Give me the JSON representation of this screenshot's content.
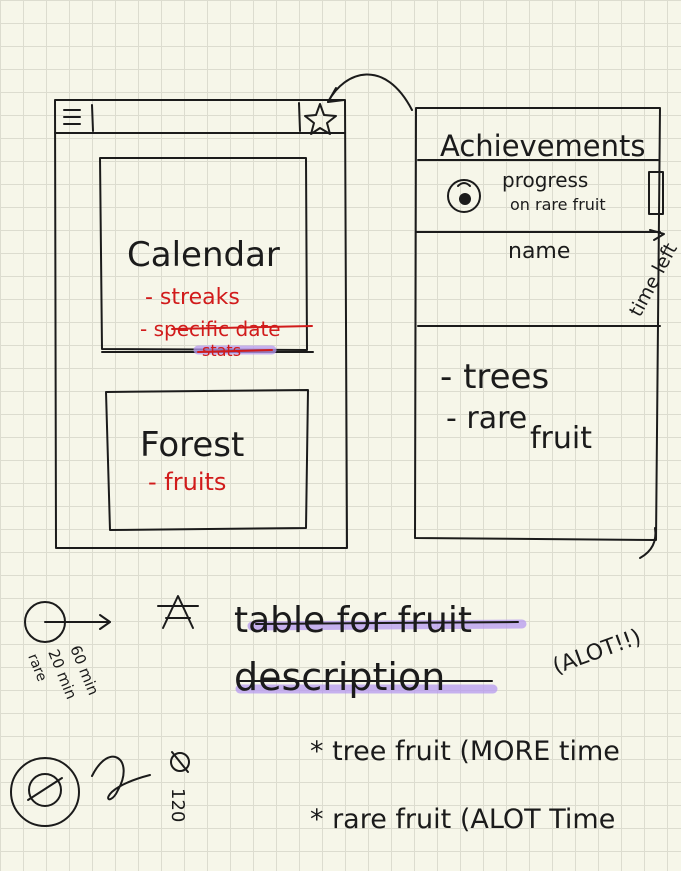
{
  "home": {
    "calendar_title": "Calendar",
    "calendar_items": [
      "- streaks",
      "- specific date",
      "stats"
    ],
    "forest_title": "Forest",
    "forest_items": [
      "- fruits"
    ]
  },
  "achievements": {
    "title": "Achievements",
    "progress_line1": "progress",
    "progress_line2": "on rare fruit",
    "name": "name",
    "time_left": "time left",
    "list": [
      "- trees",
      "- rare",
      "fruit"
    ]
  },
  "notes": {
    "table_line1": "table for fruit",
    "table_line2": "description",
    "tree_fruit": "* tree fruit (MORE time",
    "rare_fruit": "* rare fruit (ALOT Time",
    "alot": "(ALOT!!)",
    "sixty": "60 min",
    "twenty": "20 min",
    "rare": "rare",
    "onetwenty": "120"
  },
  "colors": {
    "ink": "#1b1b1b",
    "red": "#d11b1b",
    "highlight": "#b79af0",
    "paper": "#f6f6e9"
  }
}
